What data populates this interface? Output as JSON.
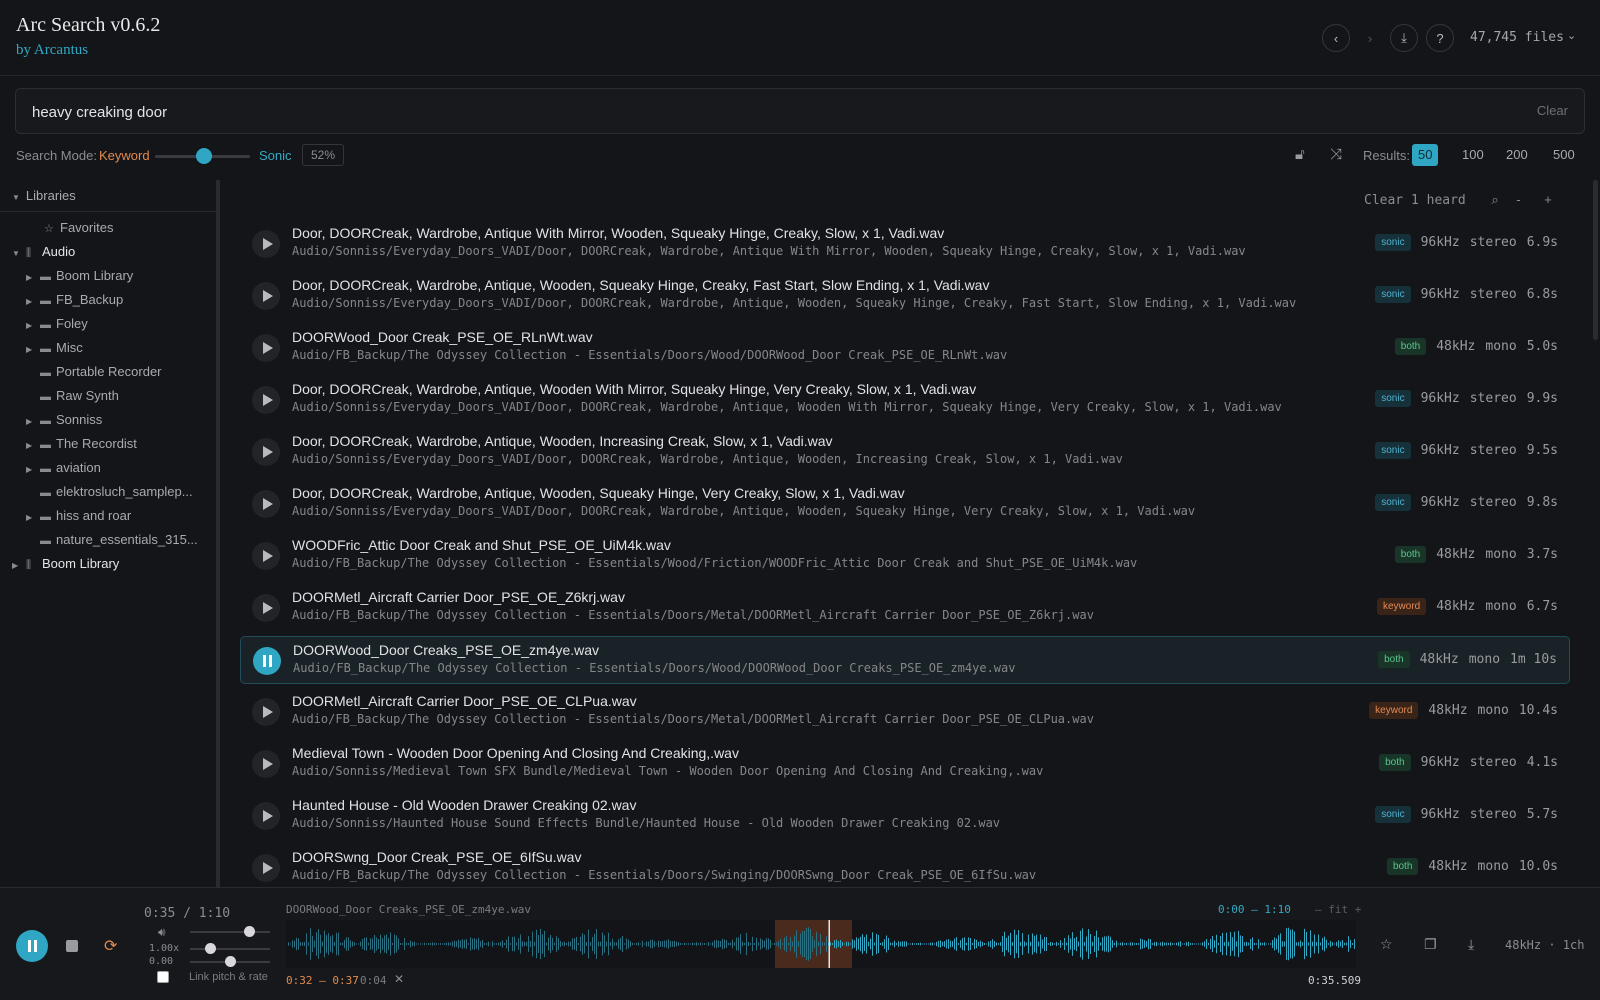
{
  "app": {
    "title": "Arc Search v0.6.2",
    "subtitle": "by Arcantus"
  },
  "header": {
    "file_count": "47,745 files",
    "back_icon": "chevron-left-icon",
    "forward_icon": "chevron-right-icon"
  },
  "search": {
    "query": "heavy creaking door",
    "clear_label": "Clear"
  },
  "mode": {
    "label": "Search Mode:",
    "keyword": "Keyword",
    "sonic": "Sonic",
    "percent": "52%",
    "blend": 0.52
  },
  "results": {
    "label": "Results:",
    "options": [
      "50",
      "100",
      "200",
      "500"
    ],
    "active": "50"
  },
  "colors": {
    "accent": "#2fa7c4",
    "keyword": "#e08a4e",
    "both": "#5bc48f"
  },
  "sidebar": {
    "header": "Libraries",
    "items": [
      {
        "label": "Favorites"
      },
      {
        "label": "Audio"
      },
      {
        "label": "Boom Library"
      },
      {
        "label": "FB_Backup"
      },
      {
        "label": "Foley"
      },
      {
        "label": "Misc"
      },
      {
        "label": "Portable Recorder"
      },
      {
        "label": "Raw Synth"
      },
      {
        "label": "Sonniss"
      },
      {
        "label": "The Recordist"
      },
      {
        "label": "aviation"
      },
      {
        "label": "elektrosluch_samplep..."
      },
      {
        "label": "hiss and roar"
      },
      {
        "label": "nature_essentials_315..."
      },
      {
        "label": "Boom Library"
      }
    ]
  },
  "list": {
    "clear_heard": "Clear 1 heard",
    "rows": [
      {
        "name": "Door, DOORCreak, Wardrobe, Antique With Mirror, Wooden, Squeaky Hinge, Creaky, Slow, x 1, Vadi.wav",
        "path": "Audio/Sonniss/Everyday_Doors_VADI/Door, DOORCreak, Wardrobe, Antique With Mirror, Wooden, Squeaky Hinge, Creaky, Slow, x 1, Vadi.wav",
        "badge": "sonic",
        "rate": "96kHz",
        "ch": "stereo",
        "dur": "6.9s"
      },
      {
        "name": "Door, DOORCreak, Wardrobe, Antique, Wooden, Squeaky Hinge, Creaky, Fast Start, Slow Ending, x 1, Vadi.wav",
        "path": "Audio/Sonniss/Everyday_Doors_VADI/Door, DOORCreak, Wardrobe, Antique, Wooden, Squeaky Hinge, Creaky, Fast Start, Slow Ending, x 1, Vadi.wav",
        "badge": "sonic",
        "rate": "96kHz",
        "ch": "stereo",
        "dur": "6.8s"
      },
      {
        "name": "DOORWood_Door Creak_PSE_OE_RLnWt.wav",
        "path": "Audio/FB_Backup/The Odyssey Collection - Essentials/Doors/Wood/DOORWood_Door Creak_PSE_OE_RLnWt.wav",
        "badge": "both",
        "rate": "48kHz",
        "ch": "mono",
        "dur": "5.0s"
      },
      {
        "name": "Door, DOORCreak, Wardrobe, Antique, Wooden With Mirror, Squeaky Hinge, Very Creaky, Slow, x 1, Vadi.wav",
        "path": "Audio/Sonniss/Everyday_Doors_VADI/Door, DOORCreak, Wardrobe, Antique, Wooden With Mirror, Squeaky Hinge, Very Creaky, Slow, x 1, Vadi.wav",
        "badge": "sonic",
        "rate": "96kHz",
        "ch": "stereo",
        "dur": "9.9s"
      },
      {
        "name": "Door, DOORCreak, Wardrobe, Antique, Wooden, Increasing Creak, Slow, x 1, Vadi.wav",
        "path": "Audio/Sonniss/Everyday_Doors_VADI/Door, DOORCreak, Wardrobe, Antique, Wooden, Increasing Creak, Slow, x 1, Vadi.wav",
        "badge": "sonic",
        "rate": "96kHz",
        "ch": "stereo",
        "dur": "9.5s"
      },
      {
        "name": "Door, DOORCreak, Wardrobe, Antique, Wooden, Squeaky Hinge, Very Creaky, Slow, x 1, Vadi.wav",
        "path": "Audio/Sonniss/Everyday_Doors_VADI/Door, DOORCreak, Wardrobe, Antique, Wooden, Squeaky Hinge, Very Creaky, Slow, x 1, Vadi.wav",
        "badge": "sonic",
        "rate": "96kHz",
        "ch": "stereo",
        "dur": "9.8s"
      },
      {
        "name": "WOODFric_Attic Door Creak and Shut_PSE_OE_UiM4k.wav",
        "path": "Audio/FB_Backup/The Odyssey Collection - Essentials/Wood/Friction/WOODFric_Attic Door Creak and Shut_PSE_OE_UiM4k.wav",
        "badge": "both",
        "rate": "48kHz",
        "ch": "mono",
        "dur": "3.7s"
      },
      {
        "name": "DOORMetl_Aircraft Carrier Door_PSE_OE_Z6krj.wav",
        "path": "Audio/FB_Backup/The Odyssey Collection - Essentials/Doors/Metal/DOORMetl_Aircraft Carrier Door_PSE_OE_Z6krj.wav",
        "badge": "keyword",
        "rate": "48kHz",
        "ch": "mono",
        "dur": "6.7s"
      },
      {
        "name": "DOORWood_Door Creaks_PSE_OE_zm4ye.wav",
        "path": "Audio/FB_Backup/The Odyssey Collection - Essentials/Doors/Wood/DOORWood_Door Creaks_PSE_OE_zm4ye.wav",
        "badge": "both",
        "rate": "48kHz",
        "ch": "mono",
        "dur": "1m 10s",
        "playing": true
      },
      {
        "name": "DOORMetl_Aircraft Carrier Door_PSE_OE_CLPua.wav",
        "path": "Audio/FB_Backup/The Odyssey Collection - Essentials/Doors/Metal/DOORMetl_Aircraft Carrier Door_PSE_OE_CLPua.wav",
        "badge": "keyword",
        "rate": "48kHz",
        "ch": "mono",
        "dur": "10.4s"
      },
      {
        "name": "Medieval Town - Wooden Door Opening And Closing And Creaking,.wav",
        "path": "Audio/Sonniss/Medieval Town SFX Bundle/Medieval Town - Wooden Door Opening And Closing And Creaking,.wav",
        "badge": "both",
        "rate": "96kHz",
        "ch": "stereo",
        "dur": "4.1s"
      },
      {
        "name": "Haunted House - Old Wooden Drawer Creaking 02.wav",
        "path": "Audio/Sonniss/Haunted House Sound Effects Bundle/Haunted House - Old Wooden Drawer Creaking 02.wav",
        "badge": "sonic",
        "rate": "96kHz",
        "ch": "stereo",
        "dur": "5.7s"
      },
      {
        "name": "DOORSwng_Door Creak_PSE_OE_6IfSu.wav",
        "path": "Audio/FB_Backup/The Odyssey Collection - Essentials/Doors/Swinging/DOORSwng_Door Creak_PSE_OE_6IfSu.wav",
        "badge": "both",
        "rate": "48kHz",
        "ch": "mono",
        "dur": "10.0s"
      }
    ]
  },
  "player": {
    "time": "0:35 / 1:10",
    "rate": "1.00x",
    "pitch": "0.00",
    "link_label": "Link pitch & rate",
    "file": "DOORWood_Door Creaks_PSE_OE_zm4ye.wav",
    "view_range": "0:00 – 1:10",
    "fit": "– fit +",
    "selection": "0:32 – 0:37",
    "selection_len": "0:04",
    "cursor": "0:35.509",
    "format": "48kHz · 1ch",
    "progress": 0.507,
    "sel_start": 0.457,
    "sel_end": 0.529
  }
}
